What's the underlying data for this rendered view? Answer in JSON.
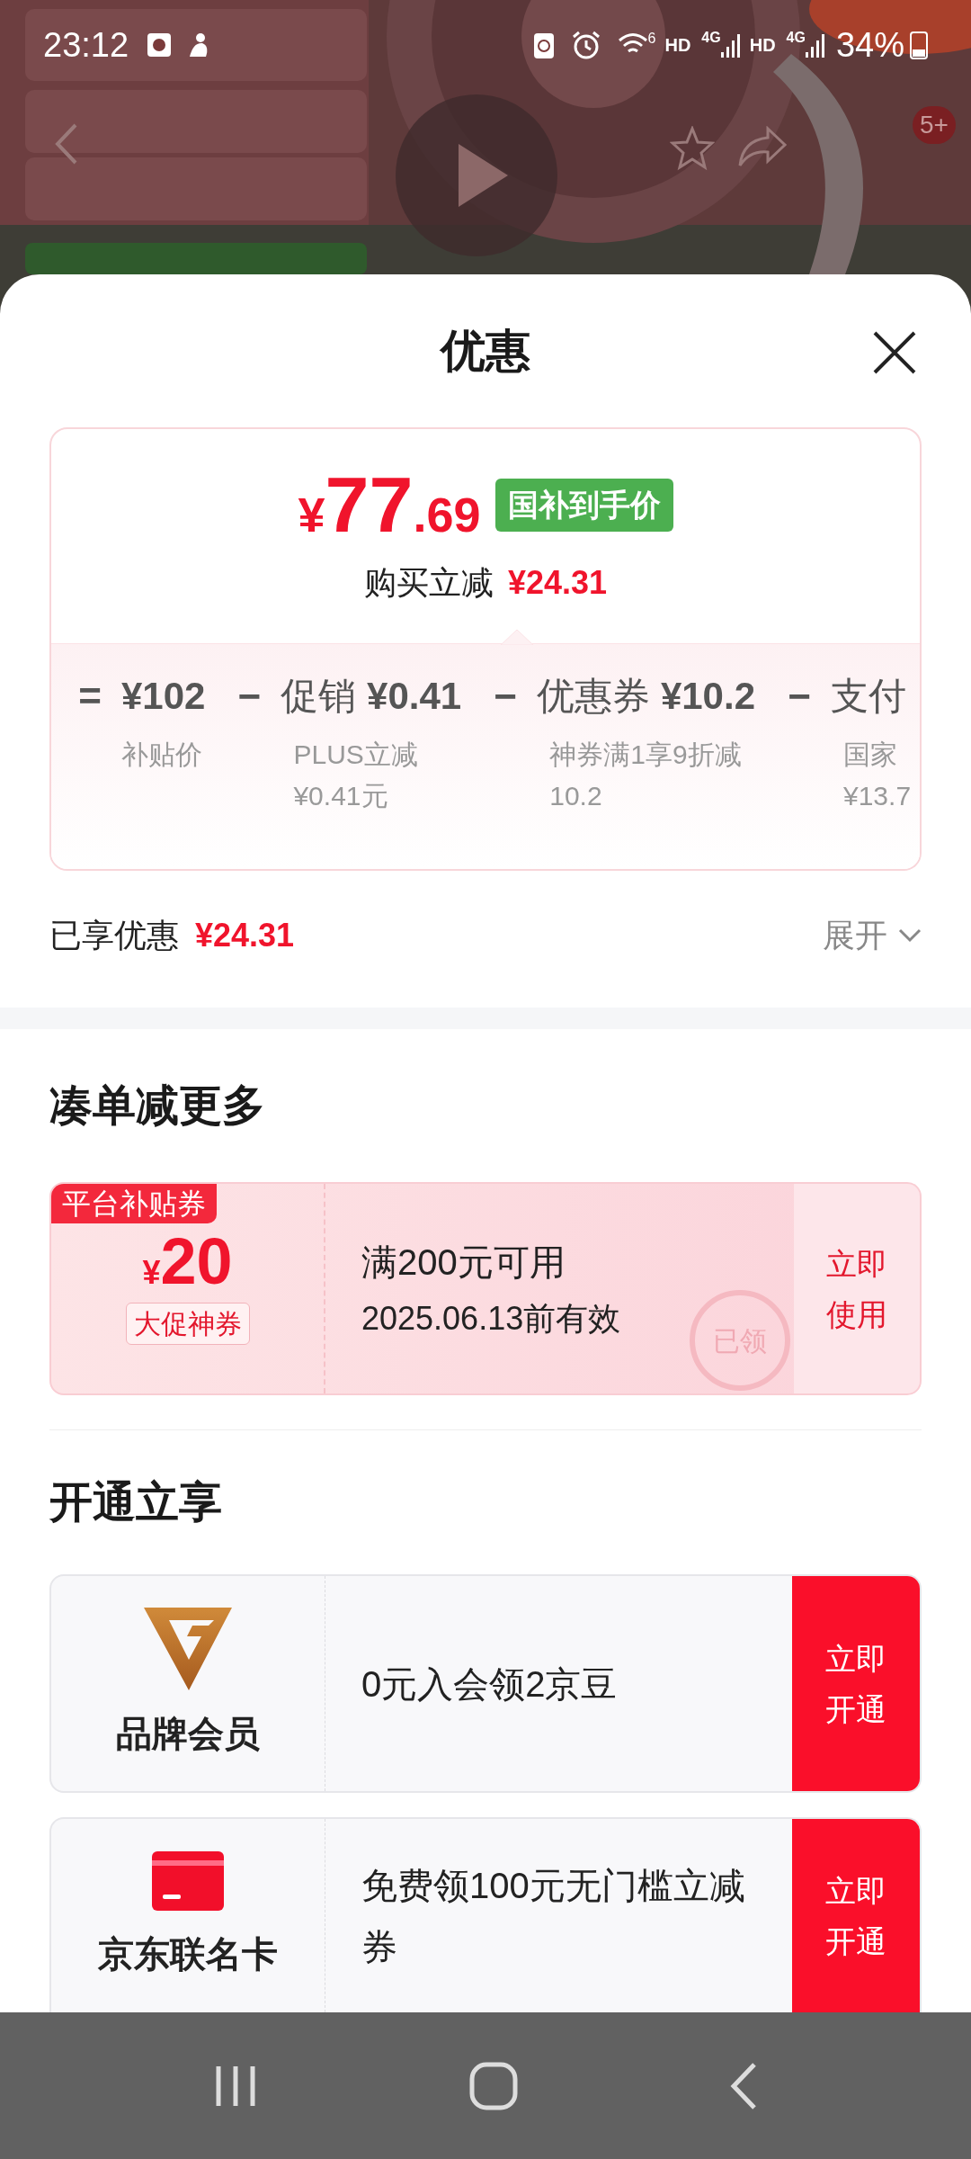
{
  "status_bar": {
    "time": "23:12",
    "wifi_label": "6",
    "networks": [
      {
        "hd": "HD",
        "gen": "4G"
      },
      {
        "hd": "HD",
        "gen": "4G"
      }
    ],
    "battery": "34%"
  },
  "product_header": {
    "kind": "picture",
    "cart_badge": "5+"
  },
  "sheet": {
    "title": "优惠"
  },
  "price_card": {
    "currency": "¥",
    "integer": "77",
    "decimal": ".69",
    "badge": "国补到手价",
    "saving_label": "购买立减",
    "saving_amount": "¥24.31",
    "breakdown": [
      {
        "op": "=",
        "amount": "¥102",
        "lines": [
          "补贴价"
        ]
      },
      {
        "op": "−",
        "label": "促销",
        "amount": "¥0.41",
        "lines": [
          "PLUS立减",
          "¥0.41元"
        ]
      },
      {
        "op": "−",
        "label": "优惠券",
        "amount": "¥10.2",
        "lines": [
          "神券满1享9折减",
          "10.2"
        ]
      },
      {
        "op": "−",
        "label": "支付",
        "lines": [
          "国家",
          "¥13.7"
        ]
      }
    ]
  },
  "summary": {
    "label": "已享优惠",
    "amount": "¥24.31",
    "expand": "展开",
    "expanded": false
  },
  "sections": [
    {
      "kind": "coupons",
      "title": "凑单减更多",
      "items": [
        {
          "tag": "平台补贴券",
          "currency": "¥",
          "value": "20",
          "type_label": "大促神券",
          "condition": "满200元可用",
          "validity": "2025.06.13前有效",
          "stamp": "已领",
          "action": "立即使用"
        }
      ]
    },
    {
      "kind": "offers",
      "title": "开通立享",
      "items": [
        {
          "kind": "brand",
          "name": "品牌会员",
          "text": "0元入会领2京豆",
          "action": "立即开通"
        },
        {
          "kind": "card",
          "name": "京东联名卡",
          "text": "免费领100元无门槛立减券",
          "action": "立即开通"
        }
      ]
    }
  ]
}
